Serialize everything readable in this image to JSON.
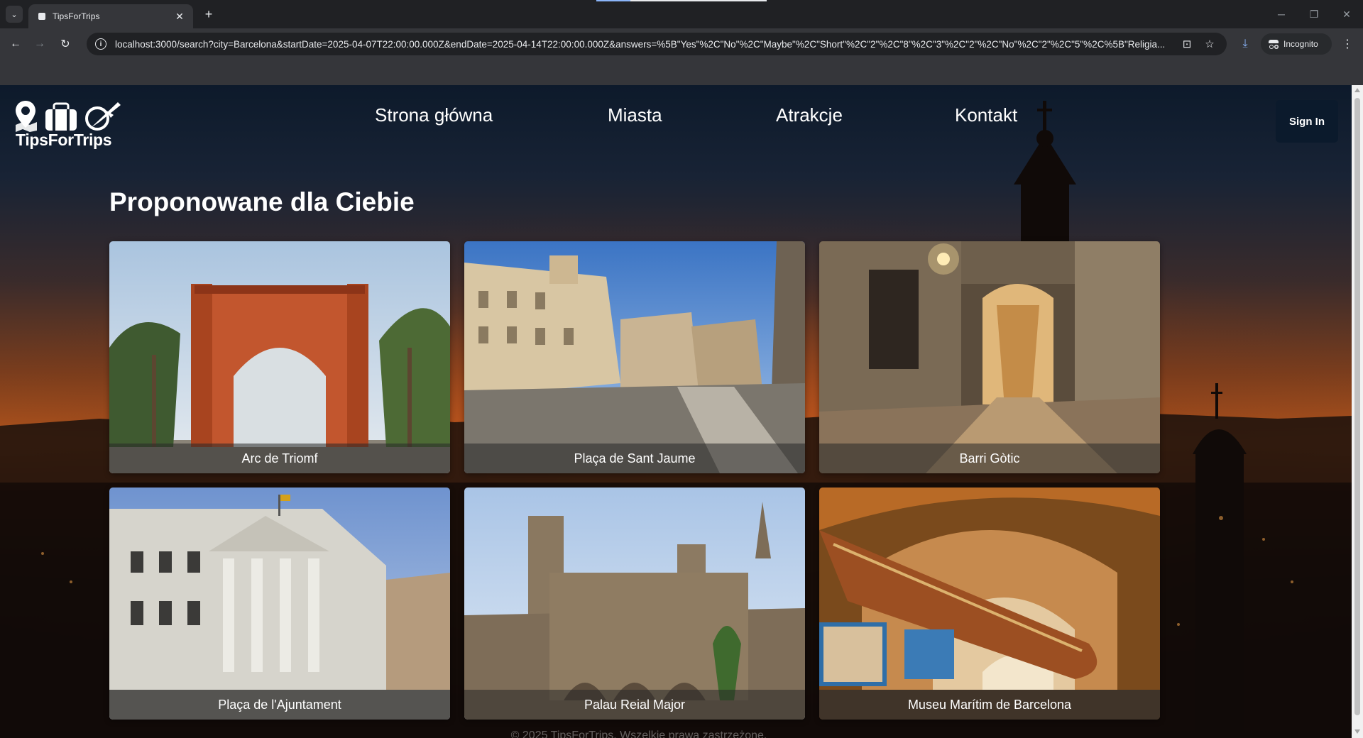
{
  "browser": {
    "tab": {
      "title": "TipsForTrips",
      "favicon": "page-icon",
      "close_icon": "close-icon"
    },
    "new_tab_icon": "plus-icon",
    "window_controls": [
      "minimize-icon",
      "restore-icon",
      "close-icon"
    ],
    "url": "localhost:3000/search?city=Barcelona&startDate=2025-04-07T22:00:00.000Z&endDate=2025-04-14T22:00:00.000Z&answers=%5B\"Yes\"%2C\"No\"%2C\"Maybe\"%2C\"Short\"%2C\"2\"%2C\"8\"%2C\"3\"%2C\"2\"%2C\"No\"%2C\"2\"%2C\"5\"%2C%5B\"Religia...",
    "incognito_label": "Incognito",
    "icons": {
      "back": "←",
      "forward": "→",
      "reload": "↻",
      "tab_list": "⌄",
      "site_info": "i",
      "translate": "⊡",
      "bookmark": "☆",
      "download": "⤓",
      "menu": "⋮",
      "close": "✕",
      "plus": "+",
      "minimize": "─",
      "restore": "❐"
    }
  },
  "site": {
    "logo_text": "TipsForTrips",
    "nav": [
      "Strona główna",
      "Miasta",
      "Atrakcje",
      "Kontakt"
    ],
    "sign_in": "Sign In",
    "section_title": "Proponowane dla Ciebie",
    "cards": [
      {
        "name": "Arc de Triomf"
      },
      {
        "name": "Plaça de Sant Jaume"
      },
      {
        "name": "Barri Gòtic"
      },
      {
        "name": "Plaça de l'Ajuntament"
      },
      {
        "name": "Palau Reial Major"
      },
      {
        "name": "Museu Marítim de Barcelona"
      }
    ],
    "footer": "© 2025 TipsForTrips. Wszelkie prawa zastrzeżone."
  },
  "colors": {
    "chrome_bg": "#202124",
    "toolbar_bg": "#35363a",
    "sign_in_bg": "#0b1a2c",
    "sunset_orange": "#d0601e",
    "night_sky": "#0d1a2b"
  }
}
